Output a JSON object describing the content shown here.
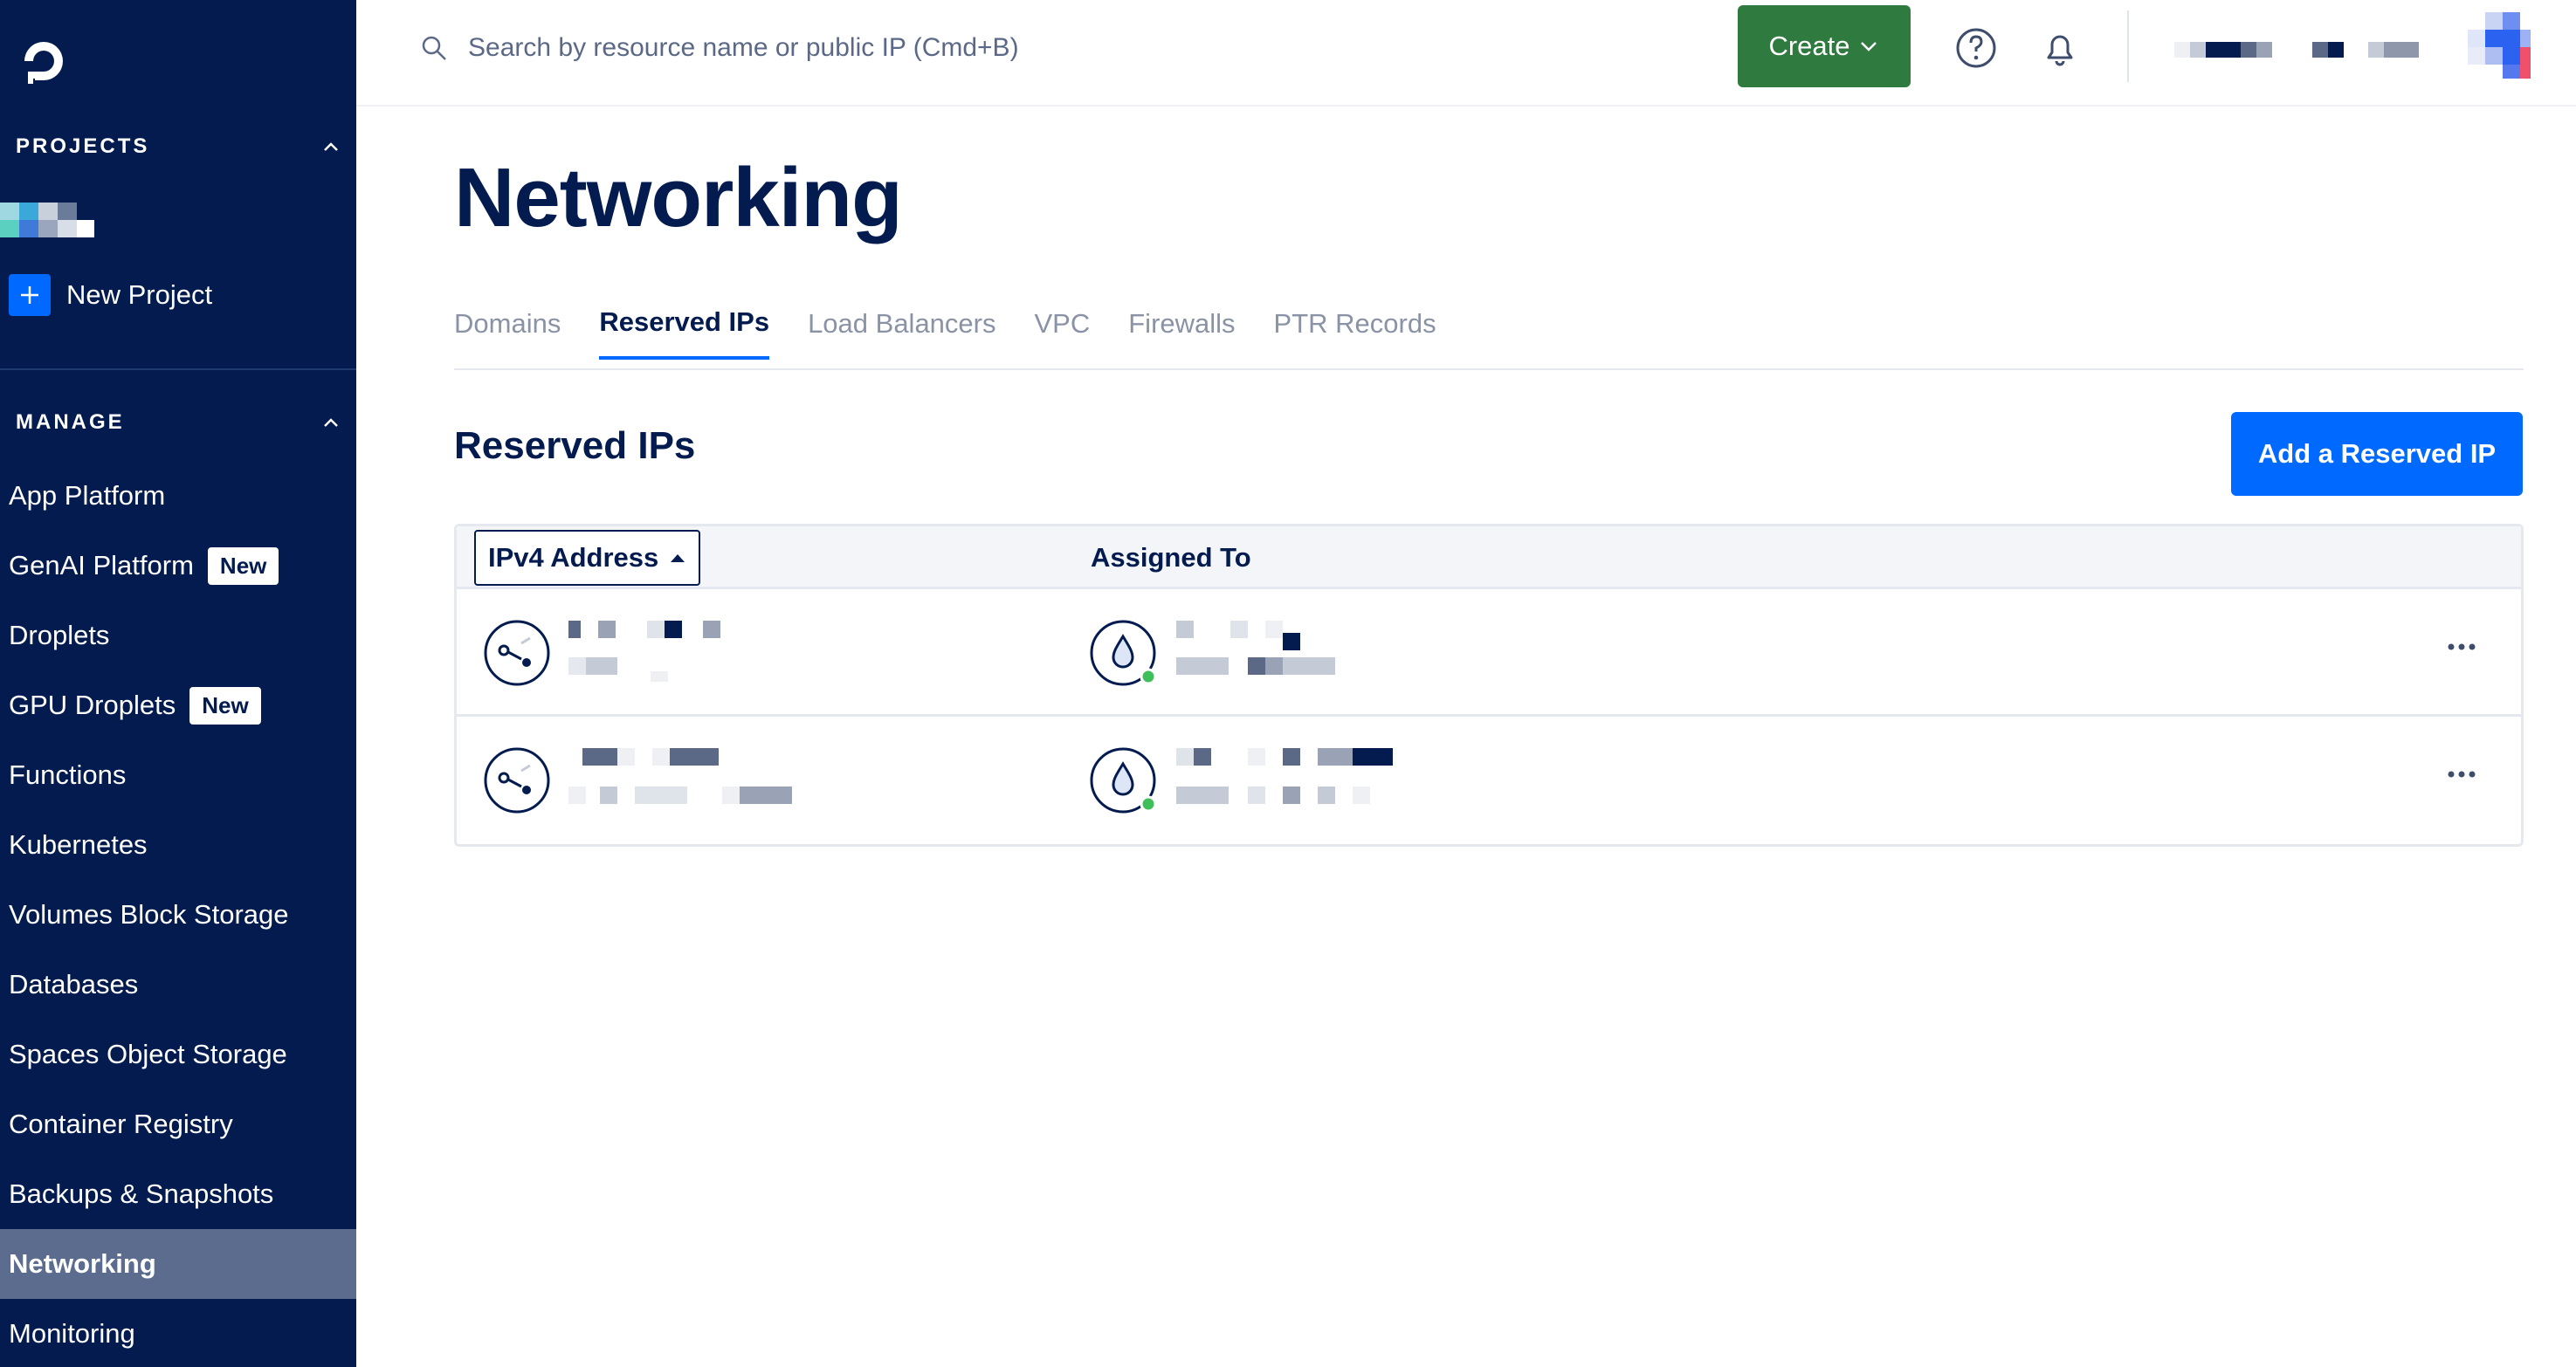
{
  "sidebar": {
    "projects_heading": "PROJECTS",
    "new_project_label": "New Project",
    "manage_heading": "MANAGE",
    "items": [
      {
        "label": "App Platform",
        "badge": ""
      },
      {
        "label": "GenAI Platform",
        "badge": "New"
      },
      {
        "label": "Droplets",
        "badge": ""
      },
      {
        "label": "GPU Droplets",
        "badge": "New"
      },
      {
        "label": "Functions",
        "badge": ""
      },
      {
        "label": "Kubernetes",
        "badge": ""
      },
      {
        "label": "Volumes Block Storage",
        "badge": ""
      },
      {
        "label": "Databases",
        "badge": ""
      },
      {
        "label": "Spaces Object Storage",
        "badge": ""
      },
      {
        "label": "Container Registry",
        "badge": ""
      },
      {
        "label": "Backups & Snapshots",
        "badge": ""
      },
      {
        "label": "Networking",
        "badge": "",
        "active": true
      },
      {
        "label": "Monitoring",
        "badge": ""
      }
    ]
  },
  "header": {
    "search_placeholder": "Search by resource name or public IP (Cmd+B)",
    "create_label": "Create",
    "icons": [
      "search-icon",
      "help-icon",
      "bell-icon",
      "chevron-down-icon"
    ]
  },
  "main": {
    "title": "Networking",
    "tabs": [
      {
        "label": "Domains"
      },
      {
        "label": "Reserved IPs",
        "active": true
      },
      {
        "label": "Load Balancers"
      },
      {
        "label": "VPC"
      },
      {
        "label": "Firewalls"
      },
      {
        "label": "PTR Records"
      }
    ],
    "section_title": "Reserved IPs",
    "add_button_label": "Add a Reserved IP",
    "table": {
      "columns": [
        "IPv4 Address",
        "Assigned To"
      ],
      "sort_indicator": "ascending",
      "rows": [
        {
          "ip_redacted": true,
          "assigned_redacted": true,
          "status": "active"
        },
        {
          "ip_redacted": true,
          "assigned_redacted": true,
          "status": "active"
        }
      ]
    }
  },
  "colors": {
    "sidebar_bg": "#031b4e",
    "accent_blue": "#0069ff",
    "create_green": "#2f7a3f",
    "status_green": "#3fbf5a"
  }
}
